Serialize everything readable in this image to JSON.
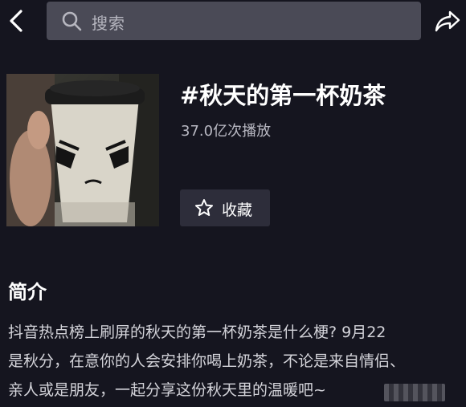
{
  "header": {
    "back_icon": "chevron-left-icon",
    "search_placeholder": "搜索",
    "search_icon": "search-icon",
    "share_icon": "share-icon"
  },
  "topic": {
    "title": "#秋天的第一杯奶茶",
    "plays": "37.0亿次播放",
    "favorite_label": "收藏",
    "favorite_icon": "star-outline-icon"
  },
  "intro": {
    "heading": "简介",
    "lines": [
      "抖音热点榜上刷屏的秋天的第一杯奶茶是什么梗? 9月22",
      "是秋分，在意你的人会安排你喝上奶茶，不论是来自情侣、",
      "亲人或是朋友，一起分享这份秋天里的温暖吧~"
    ]
  },
  "colors": {
    "background": "#15151f",
    "search_bg": "#4a4a56",
    "button_bg": "#2d2d3a",
    "muted_text": "#b8b8c2"
  }
}
